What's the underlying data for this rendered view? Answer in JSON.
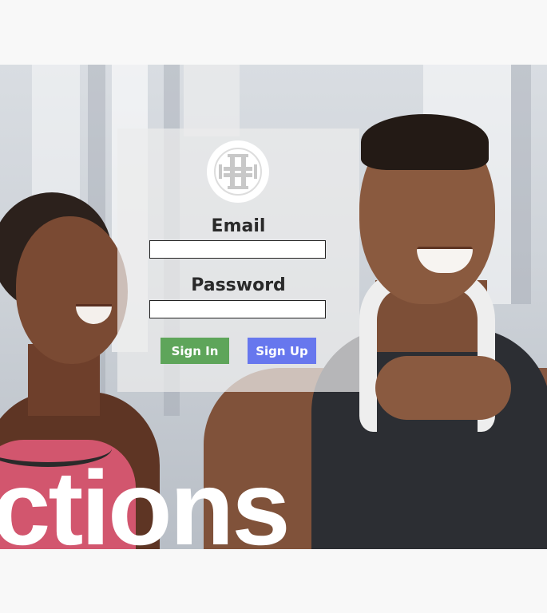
{
  "hero": {
    "background_text": "ctions",
    "image_description_icon": "fitness-couple-photo"
  },
  "login": {
    "logo_icon": "gym-logo-icon",
    "email_label": "Email",
    "email_value": "",
    "password_label": "Password",
    "password_value": "",
    "sign_in_label": "Sign In",
    "sign_up_label": "Sign Up"
  },
  "colors": {
    "page_background": "#f8f8f8",
    "sign_in": "#5ea55a",
    "sign_up": "#6777ee",
    "panel": "#ececec"
  }
}
